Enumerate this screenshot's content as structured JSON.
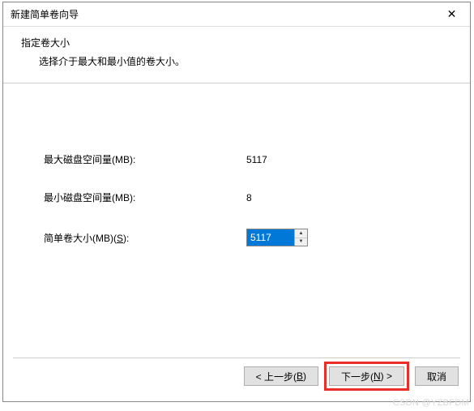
{
  "window": {
    "title": "新建简单卷向导"
  },
  "header": {
    "title": "指定卷大小",
    "subtitle": "选择介于最大和最小值的卷大小。"
  },
  "fields": {
    "max_label": "最大磁盘空间量(MB):",
    "max_value": "5117",
    "min_label": "最小磁盘空间量(MB):",
    "min_value": "8",
    "size_label_pre": "简单卷大小(MB)(",
    "size_label_hotkey": "S",
    "size_label_post": "):",
    "size_value": "5117"
  },
  "buttons": {
    "back_pre": "< 上一步(",
    "back_hotkey": "B",
    "back_post": ")",
    "next_pre": "下一步(",
    "next_hotkey": "N",
    "next_post": ") >",
    "cancel": "取消"
  },
  "watermark": "CSDN @YZBFDM"
}
